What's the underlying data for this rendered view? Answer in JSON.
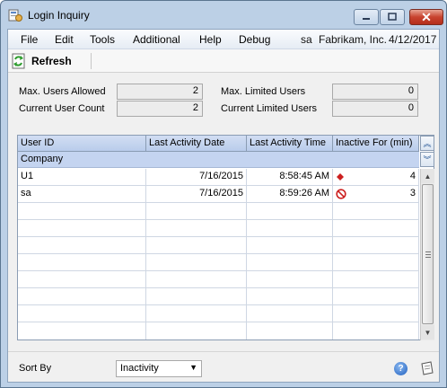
{
  "window": {
    "title": "Login Inquiry"
  },
  "menu": {
    "items": [
      "File",
      "Edit",
      "Tools",
      "Additional",
      "Help",
      "Debug"
    ],
    "user": "sa",
    "company": "Fabrikam, Inc.",
    "date": "4/12/2017"
  },
  "toolbar": {
    "refresh_label": "Refresh"
  },
  "fields": {
    "max_users_allowed": {
      "label": "Max. Users Allowed",
      "value": "2"
    },
    "current_user_count": {
      "label": "Current User Count",
      "value": "2"
    },
    "max_limited_users": {
      "label": "Max. Limited Users",
      "value": "0"
    },
    "current_limited_users": {
      "label": "Current Limited Users",
      "value": "0"
    }
  },
  "grid": {
    "columns": [
      "User ID",
      "Last Activity Date",
      "Last Activity Time",
      "Inactive For (min)"
    ],
    "subheader": "Company",
    "rows": [
      {
        "user_id": "U1",
        "date": "7/16/2015",
        "time": "8:58:45 AM",
        "status_icon": "red-diamond-icon",
        "inactive": "4"
      },
      {
        "user_id": "sa",
        "date": "7/16/2015",
        "time": "8:59:26 AM",
        "status_icon": "no-entry-icon",
        "inactive": "3"
      }
    ],
    "empty_rows": 8
  },
  "bottom": {
    "sort_by_label": "Sort By",
    "sort_by_value": "Inactivity"
  },
  "colors": {
    "window_frame": "#bcd0e6",
    "grid_header": "#c4d4f0",
    "close_button": "#c8432f",
    "status_red": "#cc1f1f"
  }
}
